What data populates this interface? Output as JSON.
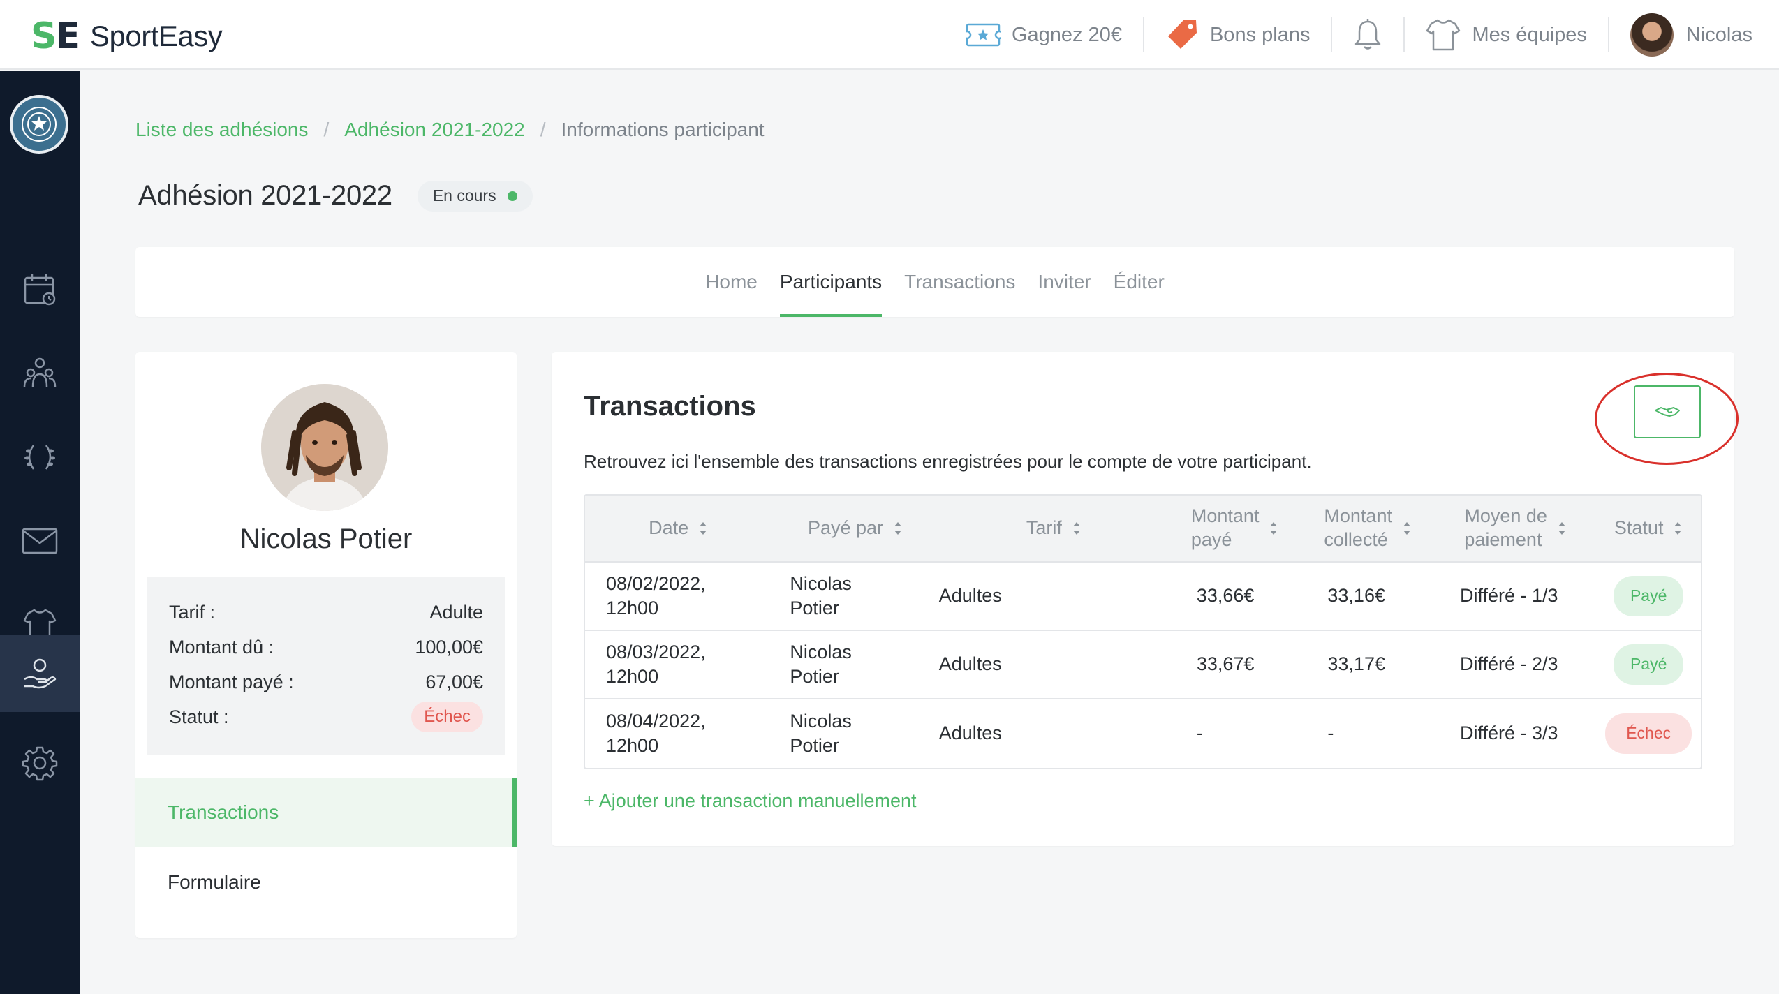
{
  "app": {
    "logo_mark_s": "S",
    "logo_mark_e": "E",
    "logo_text": "SportEasy"
  },
  "topnav": {
    "referral_label": "Gagnez 20€",
    "deals_label": "Bons plans",
    "teams_label": "Mes équipes",
    "user_name": "Nicolas"
  },
  "breadcrumb": {
    "items": [
      "Liste des adhésions",
      "Adhésion 2021-2022",
      "Informations participant"
    ],
    "separator": "/"
  },
  "page": {
    "title": "Adhésion 2021-2022",
    "status": "En cours"
  },
  "tabs": [
    "Home",
    "Participants",
    "Transactions",
    "Inviter",
    "Éditer"
  ],
  "participant": {
    "name": "Nicolas Potier",
    "tarif_label": "Tarif :",
    "tarif_value": "Adulte",
    "due_label": "Montant dû :",
    "due_value": "100,00€",
    "paid_label": "Montant payé :",
    "paid_value": "67,00€",
    "status_label": "Statut :",
    "status_value": "Échec"
  },
  "side_menu": [
    "Transactions",
    "Formulaire"
  ],
  "transactions": {
    "title": "Transactions",
    "description": "Retrouvez ici l'ensemble des transactions enregistrées pour le compte de votre participant.",
    "columns": [
      {
        "l1": "Date",
        "l2": ""
      },
      {
        "l1": "Payé par",
        "l2": ""
      },
      {
        "l1": "Tarif",
        "l2": ""
      },
      {
        "l1": "Montant",
        "l2": "payé"
      },
      {
        "l1": "Montant",
        "l2": "collecté"
      },
      {
        "l1": "Moyen de",
        "l2": "paiement"
      },
      {
        "l1": "Statut",
        "l2": ""
      }
    ],
    "rows": [
      {
        "date1": "08/02/2022,",
        "date2": "12h00",
        "payer1": "Nicolas",
        "payer2": "Potier",
        "tarif": "Adultes",
        "paid": "33,66€",
        "collected": "33,16€",
        "method": "Différé - 1/3",
        "status": "Payé"
      },
      {
        "date1": "08/03/2022,",
        "date2": "12h00",
        "payer1": "Nicolas",
        "payer2": "Potier",
        "tarif": "Adultes",
        "paid": "33,67€",
        "collected": "33,17€",
        "method": "Différé - 2/3",
        "status": "Payé"
      },
      {
        "date1": "08/04/2022,",
        "date2": "12h00",
        "payer1": "Nicolas",
        "payer2": "Potier",
        "tarif": "Adultes",
        "paid": "-",
        "collected": "-",
        "method": "Différé - 3/3",
        "status": "Échec"
      }
    ],
    "add_link": "+ Ajouter une transaction manuellement"
  },
  "colors": {
    "accent": "#4cb768",
    "sidebar_bg": "#0f1a2b",
    "danger": "#e0574f",
    "annotation": "#d9302b"
  },
  "icons": [
    "ticket-icon",
    "tag-icon",
    "bell-icon",
    "jersey-icon",
    "calendar-icon",
    "members-icon",
    "laurel-icon",
    "mail-icon",
    "shirt-icon",
    "hand-coin-icon",
    "gear-icon",
    "sort-icon",
    "handshake-icon"
  ]
}
